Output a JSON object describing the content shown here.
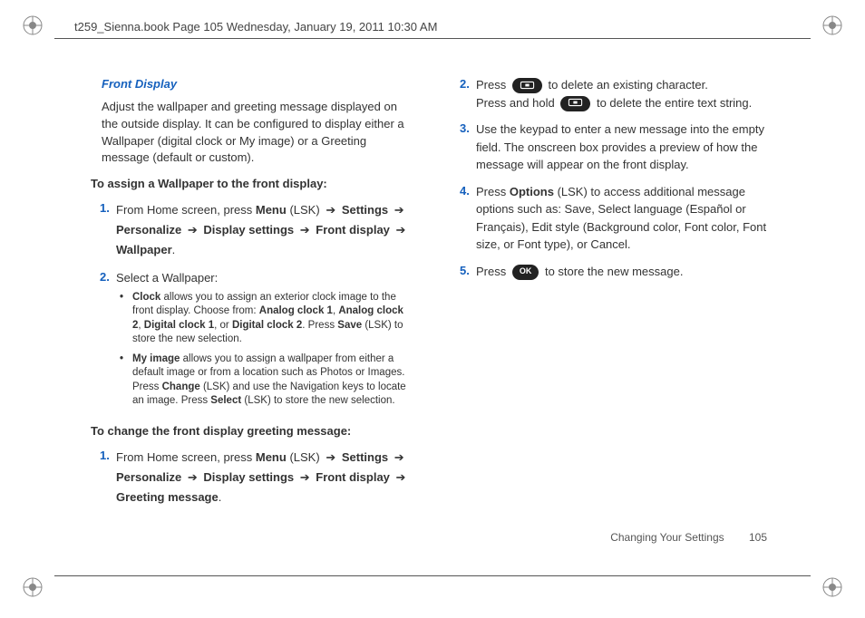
{
  "header": {
    "text": "t259_Sienna.book  Page 105  Wednesday, January 19, 2011  10:30 AM"
  },
  "subhead": "Front Display",
  "intro": "Adjust the wallpaper and greeting message displayed on the outside display. It can be configured to display either a Wallpaper (digital clock or My image) or a Greeting message (default or custom).",
  "task1": {
    "heading": "To assign a Wallpaper to the front display:",
    "step1": {
      "num": "1.",
      "prefix": "From Home screen, press ",
      "menu": "Menu",
      "lsk": "(LSK)",
      "settings": "Settings",
      "personalize": "Personalize",
      "display_settings": "Display settings",
      "front_display": "Front display",
      "wallpaper": "Wallpaper"
    },
    "step2": {
      "num": "2.",
      "text": "Select a Wallpaper:",
      "b1": {
        "label": "Clock",
        "t1": " allows you to assign an exterior clock image to the front display. Choose from: ",
        "a1": "Analog clock 1",
        "a2": "Analog clock 2",
        "d1": "Digital clock 1",
        "or": ", or ",
        "d2": "Digital clock 2",
        "press": ". Press ",
        "save": "Save",
        "tail": " (LSK) to store the new selection."
      },
      "b2": {
        "label": "My image",
        "t1": " allows you to assign a wallpaper from either a default image or from a location such as Photos or Images. Press ",
        "change": "Change",
        "mid": " (LSK) and use the Navigation keys to locate an image. Press ",
        "select": "Select",
        "tail": " (LSK) to store the new selection."
      }
    }
  },
  "task2": {
    "heading": "To change the front display greeting message:",
    "step1": {
      "num": "1.",
      "prefix": "From Home screen, press ",
      "menu": "Menu",
      "lsk": "(LSK)",
      "settings": "Settings",
      "personalize": "Personalize",
      "display_settings": "Display settings",
      "front_display": "Front display",
      "greeting": "Greeting message"
    }
  },
  "rightcol": {
    "step2": {
      "num": "2.",
      "l1a": "Press ",
      "l1b": " to delete an existing character.",
      "l2a": "Press and hold ",
      "l2b": " to delete the entire text string."
    },
    "step3": {
      "num": "3.",
      "text": "Use the keypad to enter a new message into the empty field. The onscreen box provides a preview of how the message will appear on the front display."
    },
    "step4": {
      "num": "4.",
      "t1": "Press ",
      "options": "Options",
      "t2": " (LSK) to access additional message options such as: Save, Select language (Español or Français), Edit style (Background color, Font color, Font size, or Font type), or Cancel."
    },
    "step5": {
      "num": "5.",
      "t1": "Press ",
      "ok": "OK",
      "t2": " to store the new message."
    }
  },
  "footer": {
    "section": "Changing Your Settings",
    "page": "105"
  },
  "arrow_glyph": "➔"
}
